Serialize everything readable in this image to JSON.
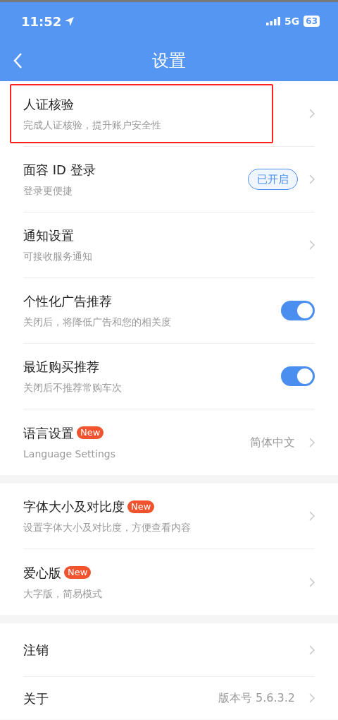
{
  "status_bar": {
    "time": "11:52",
    "network": "5G",
    "battery": "63"
  },
  "nav": {
    "title": "设置"
  },
  "sections": [
    {
      "items": [
        {
          "kind": "chevron",
          "title": "人证核验",
          "subtitle": "完成人证核验，提升账户安全性",
          "highlighted": true
        },
        {
          "kind": "badge",
          "title": "面容 ID 登录",
          "subtitle": "登录更便捷",
          "badge": "已开启",
          "highlighted": false
        },
        {
          "kind": "chevron",
          "title": "通知设置",
          "subtitle": "可接收服务通知",
          "highlighted": false
        },
        {
          "kind": "toggle",
          "title": "个性化广告推荐",
          "subtitle": "关闭后，将降低广告和您的相关度",
          "on": true,
          "highlighted": false
        },
        {
          "kind": "toggle",
          "title": "最近购买推荐",
          "subtitle": "关闭后不推荐常购车次",
          "on": true,
          "highlighted": false
        },
        {
          "kind": "value",
          "title": "语言设置",
          "tag": "New",
          "subtitle": "Language Settings",
          "value": "简体中文",
          "highlighted": false
        }
      ]
    },
    {
      "items": [
        {
          "kind": "chevron",
          "title": "字体大小及对比度",
          "tag": "New",
          "subtitle": "设置字体大小及对比度，方便查看内容",
          "highlighted": false
        },
        {
          "kind": "chevron",
          "title": "爱心版",
          "tag": "New",
          "subtitle": "大字版，简易模式",
          "highlighted": false
        }
      ]
    },
    {
      "items": [
        {
          "kind": "chevron",
          "title": "注销",
          "highlighted": false
        },
        {
          "kind": "value",
          "title": "关于",
          "value": "版本号 5.6.3.2",
          "highlighted": false
        }
      ]
    }
  ]
}
